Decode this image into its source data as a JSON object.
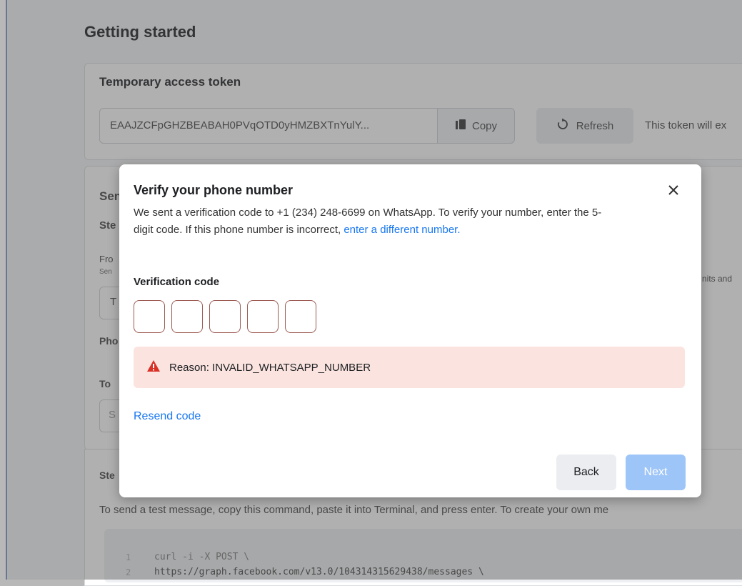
{
  "page": {
    "title": "Getting started"
  },
  "token_card": {
    "title": "Temporary access token",
    "token_value": "EAAJZCFpGHZBEABAH0PVqOTD0yHMZBXTnYulY...",
    "copy_label": "Copy",
    "refresh_label": "Refresh",
    "note": "This token will ex"
  },
  "send_card": {
    "heading_partial": "Sen",
    "step_partial": "Ste",
    "from_partial": "Fro",
    "from_sub_partial": "Sen",
    "from_value_partial": "T",
    "right_note_partial": "nits and",
    "phone_partial": "Pho",
    "to_partial": "To",
    "to_value_partial": "S"
  },
  "step2": {
    "label_partial": "Ste",
    "instruction": "To send a test message, copy this command, paste it into Terminal, and press enter. To create your own me"
  },
  "code": {
    "line_numbers": [
      "1",
      "2"
    ],
    "lines": [
      "curl -i -X POST \\",
      "  https://graph.facebook.com/v13.0/104314315629438/messages \\"
    ]
  },
  "modal": {
    "title": "Verify your phone number",
    "description": "We sent a verification code to +1 (234) 248-6699 on WhatsApp. To verify your number, enter the 5-digit code. If this phone number is incorrect, ",
    "link_text": "enter a different number.",
    "code_label": "Verification code",
    "code_digits": [
      "",
      "",
      "",
      "",
      ""
    ],
    "error_text": "Reason: INVALID_WHATSAPP_NUMBER",
    "resend_label": "Resend code",
    "back_label": "Back",
    "next_label": "Next"
  },
  "colors": {
    "link": "#1877f2",
    "error_bg": "#fbe4e0",
    "error_icon": "#d93025",
    "next_disabled": "#9ec5f8"
  },
  "icons": {
    "copy": "copy-icon",
    "refresh": "refresh-icon",
    "close": "close-icon",
    "warning": "warning-icon"
  }
}
